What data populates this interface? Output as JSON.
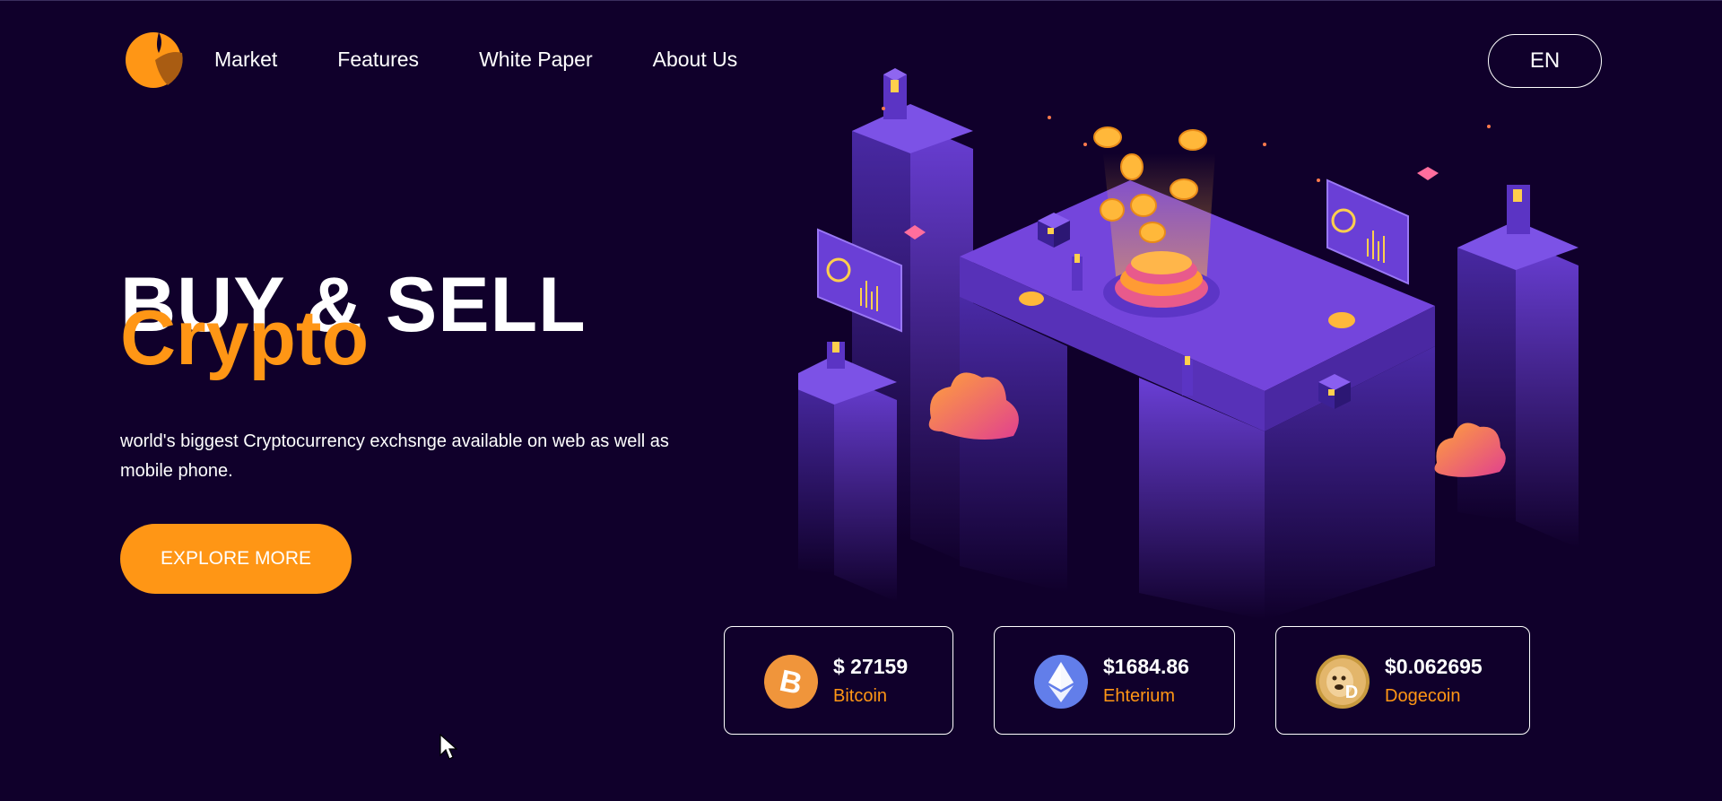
{
  "nav": {
    "links": [
      "Market",
      "Features",
      "White Paper",
      "About Us"
    ],
    "language": "EN"
  },
  "hero": {
    "title": "BUY & SELL",
    "subtitle": "Crypto",
    "description": "world's biggest Cryptocurrency exchsnge available on web as well as mobile phone.",
    "cta": "EXPLORE MORE"
  },
  "coins": [
    {
      "price": "$ 27159",
      "name": "Bitcoin",
      "icon": "bitcoin-icon"
    },
    {
      "price": "$1684.86",
      "name": "Ehterium",
      "icon": "ethereum-icon"
    },
    {
      "price": "$0.062695",
      "name": "Dogecoin",
      "icon": "dogecoin-icon"
    }
  ],
  "colors": {
    "background": "#10002b",
    "accent": "#ff9615",
    "text": "#ffffff",
    "purple": "#6b3fd4"
  }
}
